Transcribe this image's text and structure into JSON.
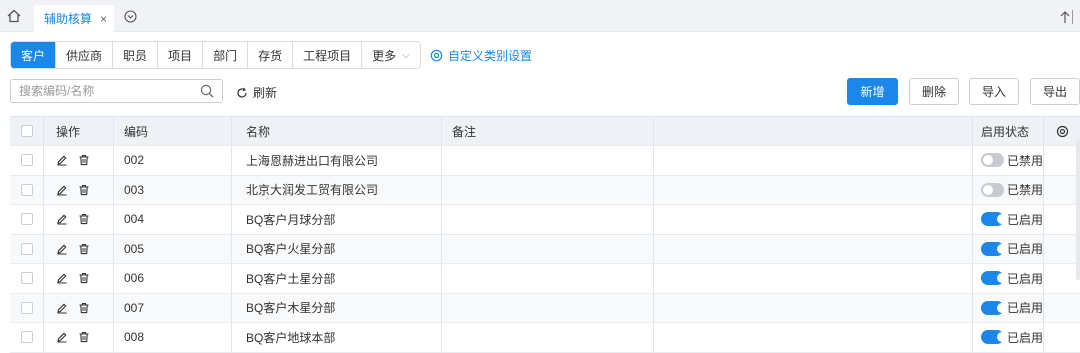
{
  "topbar": {
    "tab_label": "辅助核算",
    "tab_close": "×"
  },
  "categories": [
    {
      "label": "客户",
      "active": true
    },
    {
      "label": "供应商",
      "active": false
    },
    {
      "label": "职员",
      "active": false
    },
    {
      "label": "项目",
      "active": false
    },
    {
      "label": "部门",
      "active": false
    },
    {
      "label": "存货",
      "active": false
    },
    {
      "label": "工程项目",
      "active": false
    },
    {
      "label": "更多",
      "active": false,
      "dropdown": true
    }
  ],
  "custom_category_link": "自定义类别设置",
  "search": {
    "placeholder": "搜索编码/名称",
    "value": ""
  },
  "refresh_label": "刷新",
  "actions": {
    "add": "新增",
    "delete": "删除",
    "import": "导入",
    "export": "导出"
  },
  "table": {
    "headers": {
      "op": "操作",
      "code": "编码",
      "name": "名称",
      "note": "备注",
      "blank": "",
      "status": "启用状态"
    },
    "rows": [
      {
        "code": "002",
        "name": "上海恩赫进出口有限公司",
        "note": "",
        "enabled": false,
        "status": "已禁用"
      },
      {
        "code": "003",
        "name": "北京大润发工贸有限公司",
        "note": "",
        "enabled": false,
        "status": "已禁用"
      },
      {
        "code": "004",
        "name": "BQ客户月球分部",
        "note": "",
        "enabled": true,
        "status": "已启用"
      },
      {
        "code": "005",
        "name": "BQ客户火星分部",
        "note": "",
        "enabled": true,
        "status": "已启用"
      },
      {
        "code": "006",
        "name": "BQ客户土星分部",
        "note": "",
        "enabled": true,
        "status": "已启用"
      },
      {
        "code": "007",
        "name": "BQ客户木星分部",
        "note": "",
        "enabled": true,
        "status": "已启用"
      },
      {
        "code": "008",
        "name": "BQ客户地球本部",
        "note": "",
        "enabled": true,
        "status": "已启用"
      }
    ]
  },
  "colors": {
    "accent": "#1b88e9",
    "toggle_off": "#c7cbd1",
    "header_bg": "#eef1f5"
  },
  "icons": {
    "home": "home-icon",
    "tab_menu": "chevron-down-circle-icon",
    "scroll_top": "arrow-up-icon",
    "custom": "settings-icon",
    "search": "search-icon",
    "refresh": "refresh-icon",
    "edit": "edit-icon",
    "delete": "trash-icon",
    "column_settings": "gear-icon"
  }
}
